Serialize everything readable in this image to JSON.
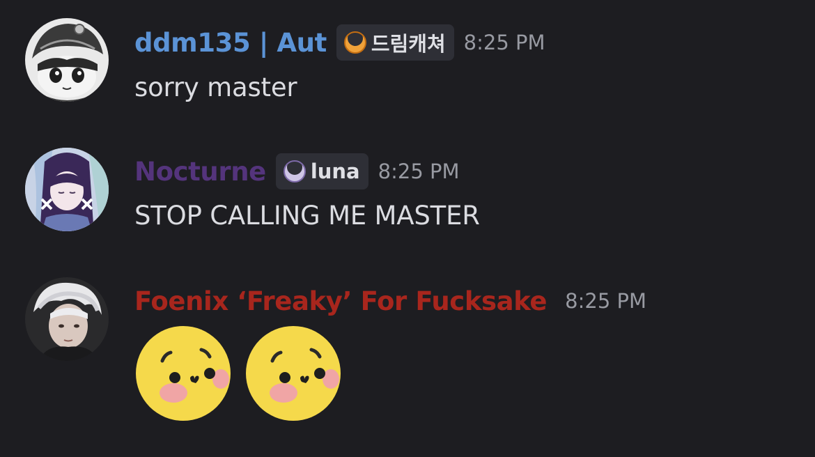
{
  "messages": [
    {
      "username": "ddm135 | Aut",
      "username_color": "#5b93d6",
      "tag": {
        "label": "드림캐쳐",
        "icon": "orange-crescent-icon"
      },
      "timestamp": "8:25 PM",
      "text": "sorry master"
    },
    {
      "username": "Nocturne",
      "username_color": "#54347c",
      "tag": {
        "label": "luna",
        "icon": "white-crescent-icon"
      },
      "timestamp": "8:25 PM",
      "text": "STOP CALLING ME MASTER"
    },
    {
      "username": "Foenix ‘Freaky’ For Fucksake",
      "username_color": "#a8261d",
      "timestamp": "8:25 PM",
      "emojis": [
        "pleading-shy-emoji",
        "pleading-shy-emoji"
      ]
    }
  ]
}
